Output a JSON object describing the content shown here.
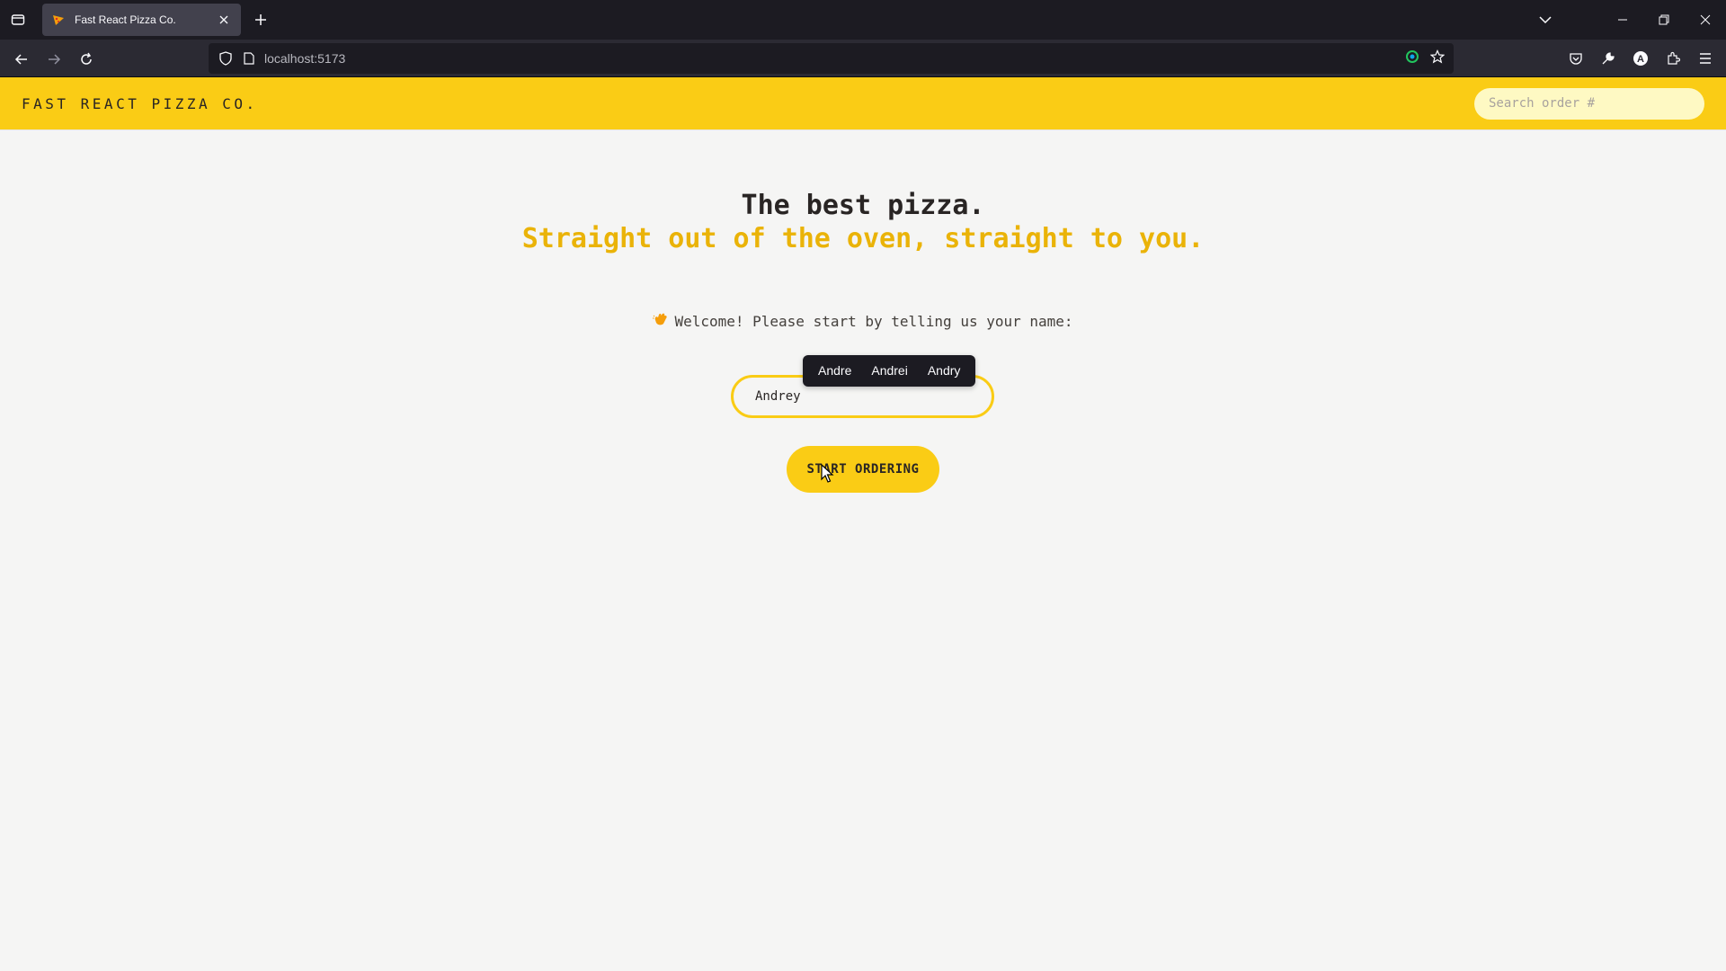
{
  "browser": {
    "tab": {
      "title": "Fast React Pizza Co.",
      "favicon": "pizza-icon"
    },
    "url": "localhost:5173"
  },
  "header": {
    "logo": "FAST REACT PIZZA CO.",
    "search_placeholder": "Search order #"
  },
  "hero": {
    "line1": "The best pizza.",
    "line2": "Straight out of the oven, straight to you."
  },
  "welcome": {
    "icon": "waving-hand-icon",
    "text": "Welcome! Please start by telling us your name:"
  },
  "name_input": {
    "value": "Andrey"
  },
  "suggestions": [
    "Andre",
    "Andrei",
    "Andry"
  ],
  "start_button": {
    "label": "START ORDERING"
  },
  "colors": {
    "brand_yellow": "#facc15",
    "accent_yellow": "#eab308",
    "page_bg": "#f5f5f4",
    "text_dark": "#292524"
  }
}
